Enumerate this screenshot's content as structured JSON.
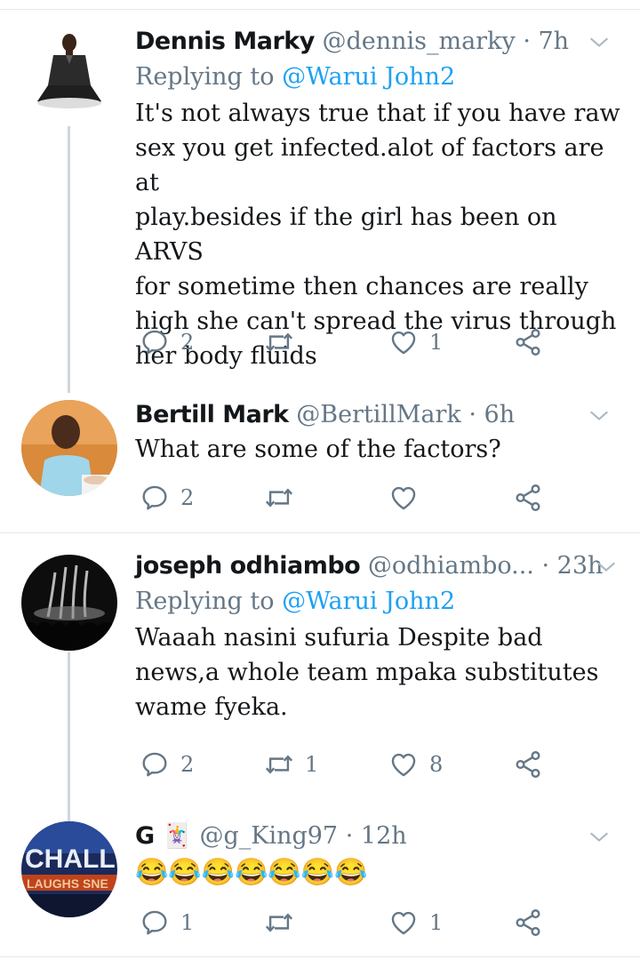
{
  "tweets": [
    {
      "name": "Dennis Marky",
      "handle": "@dennis_marky",
      "dot": "·",
      "time": "7h",
      "replying_prefix": "Replying to",
      "replying_to": "@Warui John2",
      "text_lines": [
        "It's not always true that if you have raw",
        "sex you get infected.alot of factors are at",
        "play.besides if the girl has been on ARVS",
        "for sometime then chances are really",
        "high she can't spread the virus through",
        "her body fluids"
      ],
      "reply_count": "2",
      "retweet_count": "",
      "like_count": "1"
    },
    {
      "name": "Bertill Mark",
      "handle": "@BertillMark",
      "dot": "·",
      "time": "6h",
      "text_lines": [
        "What are some of the factors?"
      ],
      "reply_count": "2",
      "retweet_count": "",
      "like_count": ""
    },
    {
      "name": "joseph odhiambo",
      "handle": "@odhiambo...",
      "dot": "·",
      "time": "23h",
      "replying_prefix": "Replying to",
      "replying_to": "@Warui John2",
      "text_lines": [
        "Waaah nasini sufuria Despite bad",
        "news,a whole team mpaka substitutes",
        "wame fyeka."
      ],
      "reply_count": "2",
      "retweet_count": "1",
      "like_count": "8"
    },
    {
      "name": "G",
      "name_emoji": "🃏",
      "handle": "@g_King97",
      "dot": "·",
      "time": "12h",
      "text": "😂😂😂😂😂😂😂",
      "reply_count": "1",
      "retweet_count": "",
      "like_count": "1"
    }
  ],
  "avatar4_text": "CHALL LAUGHS SNE",
  "colors": {
    "link": "#1da1f2",
    "muted": "#657786",
    "divider": "#e1e8ed",
    "thread_line": "#ccd6dd"
  },
  "icons": [
    "chevron-down-icon",
    "reply-icon",
    "retweet-icon",
    "like-icon",
    "share-icon"
  ]
}
